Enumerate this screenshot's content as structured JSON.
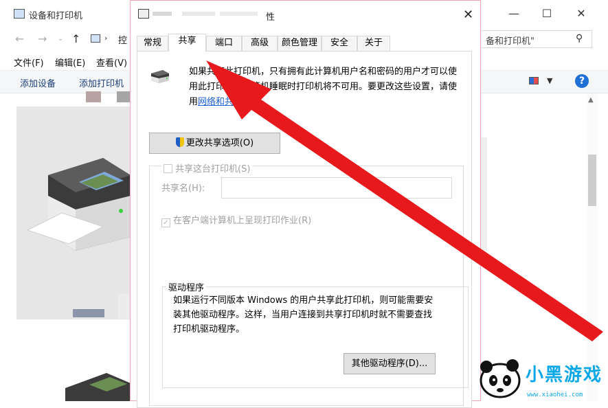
{
  "background_window": {
    "title": "设备和打印机",
    "address_fragment": "控",
    "search_placeholder": "备和打印机\"",
    "menus": [
      "文件(F)",
      "编辑(E)",
      "查看(V)"
    ],
    "toolbar": {
      "add_device": "添加设备",
      "add_printer": "添加打印机"
    },
    "controls": {
      "minimize": "—",
      "maximize": "☐",
      "close": "✕"
    }
  },
  "dialog": {
    "title_suffix": "性",
    "close": "✕",
    "tabs": [
      "常规",
      "共享",
      "端口",
      "高级",
      "颜色管理",
      "安全",
      "关于"
    ],
    "active_tab": "共享",
    "info_text_pre": "如果共享此打印机，只有拥有此计算机用户名和密码的用户才可以使用此打印机。计算机睡眠时打印机将不可用。要更改这些设置，请使用",
    "info_link": "网络和共享中心",
    "info_text_post": "。",
    "change_sharing_button": "更改共享选项(O)",
    "share_checkbox": "共享这台打印机(S)",
    "share_name_label": "共享名(H):",
    "share_name_value": "",
    "render_checkbox": "在客户端计算机上呈现打印作业(R)",
    "driver_group_title": "驱动程序",
    "driver_text": "如果运行不同版本 Windows 的用户共享此打印机，则可能需要安装其他驱动程序。这样，当用户连接到共享打印机时就不需要查找打印机驱动程序。",
    "other_drivers_button": "其他驱动程序(D)..."
  },
  "watermark": {
    "text": "小黑游戏",
    "url": "www.xiaohei.com"
  }
}
